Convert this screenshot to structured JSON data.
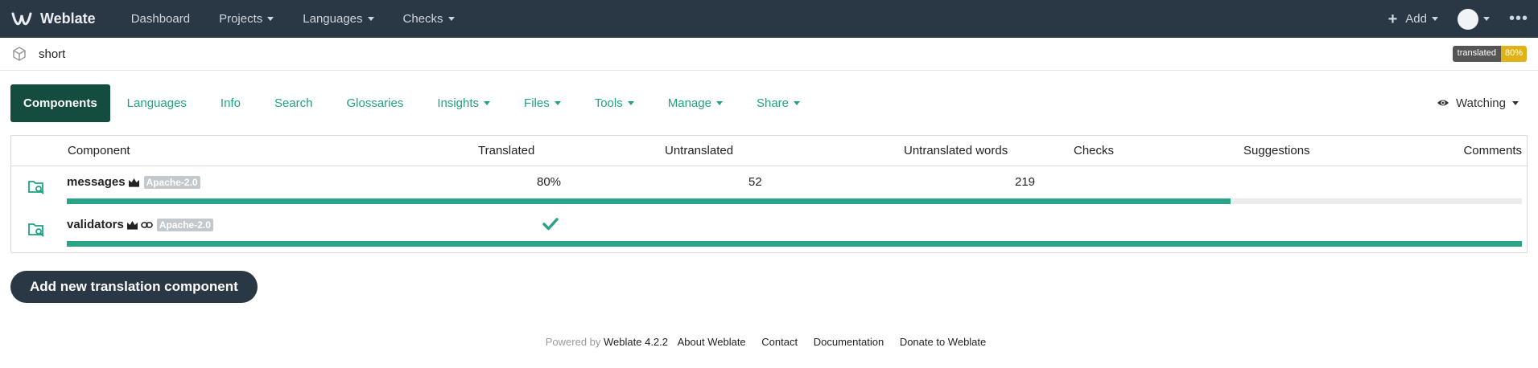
{
  "navbar": {
    "brand": "Weblate",
    "items": [
      {
        "label": "Dashboard",
        "caret": false
      },
      {
        "label": "Projects",
        "caret": true
      },
      {
        "label": "Languages",
        "caret": true
      },
      {
        "label": "Checks",
        "caret": true
      }
    ],
    "add_label": "Add",
    "more_label": "•••"
  },
  "breadcrumb": {
    "project": "short",
    "badge_label": "translated",
    "badge_value": "80%"
  },
  "tabs": {
    "items": [
      {
        "label": "Components",
        "active": true,
        "caret": false
      },
      {
        "label": "Languages",
        "active": false,
        "caret": false
      },
      {
        "label": "Info",
        "active": false,
        "caret": false
      },
      {
        "label": "Search",
        "active": false,
        "caret": false
      },
      {
        "label": "Glossaries",
        "active": false,
        "caret": false
      },
      {
        "label": "Insights",
        "active": false,
        "caret": true
      },
      {
        "label": "Files",
        "active": false,
        "caret": true
      },
      {
        "label": "Tools",
        "active": false,
        "caret": true
      },
      {
        "label": "Manage",
        "active": false,
        "caret": true
      },
      {
        "label": "Share",
        "active": false,
        "caret": true
      }
    ],
    "watching_label": "Watching"
  },
  "table": {
    "headers": [
      "Component",
      "Translated",
      "Untranslated",
      "Untranslated words",
      "Checks",
      "Suggestions",
      "Comments"
    ],
    "rows": [
      {
        "name": "messages",
        "license": "Apache-2.0",
        "linked": false,
        "translated": "80%",
        "translated_fraction": 0.8,
        "untranslated": "52",
        "untranslated_words": "219",
        "checks": "",
        "suggestions": "",
        "comments": "",
        "complete": false
      },
      {
        "name": "validators",
        "license": "Apache-2.0",
        "linked": true,
        "translated": "",
        "translated_fraction": 1.0,
        "untranslated": "",
        "untranslated_words": "",
        "checks": "",
        "suggestions": "",
        "comments": "",
        "complete": true
      }
    ]
  },
  "add_button": "Add new translation component",
  "footer": {
    "powered_by": "Powered by",
    "version": "Weblate 4.2.2",
    "links": [
      "About Weblate",
      "Contact",
      "Documentation",
      "Donate to Weblate"
    ]
  },
  "colors": {
    "navbar": "#2a3744",
    "accent": "#1fa385",
    "active_tab": "#144d3f",
    "progress": "#2ba387",
    "badge": "#dfb317"
  }
}
